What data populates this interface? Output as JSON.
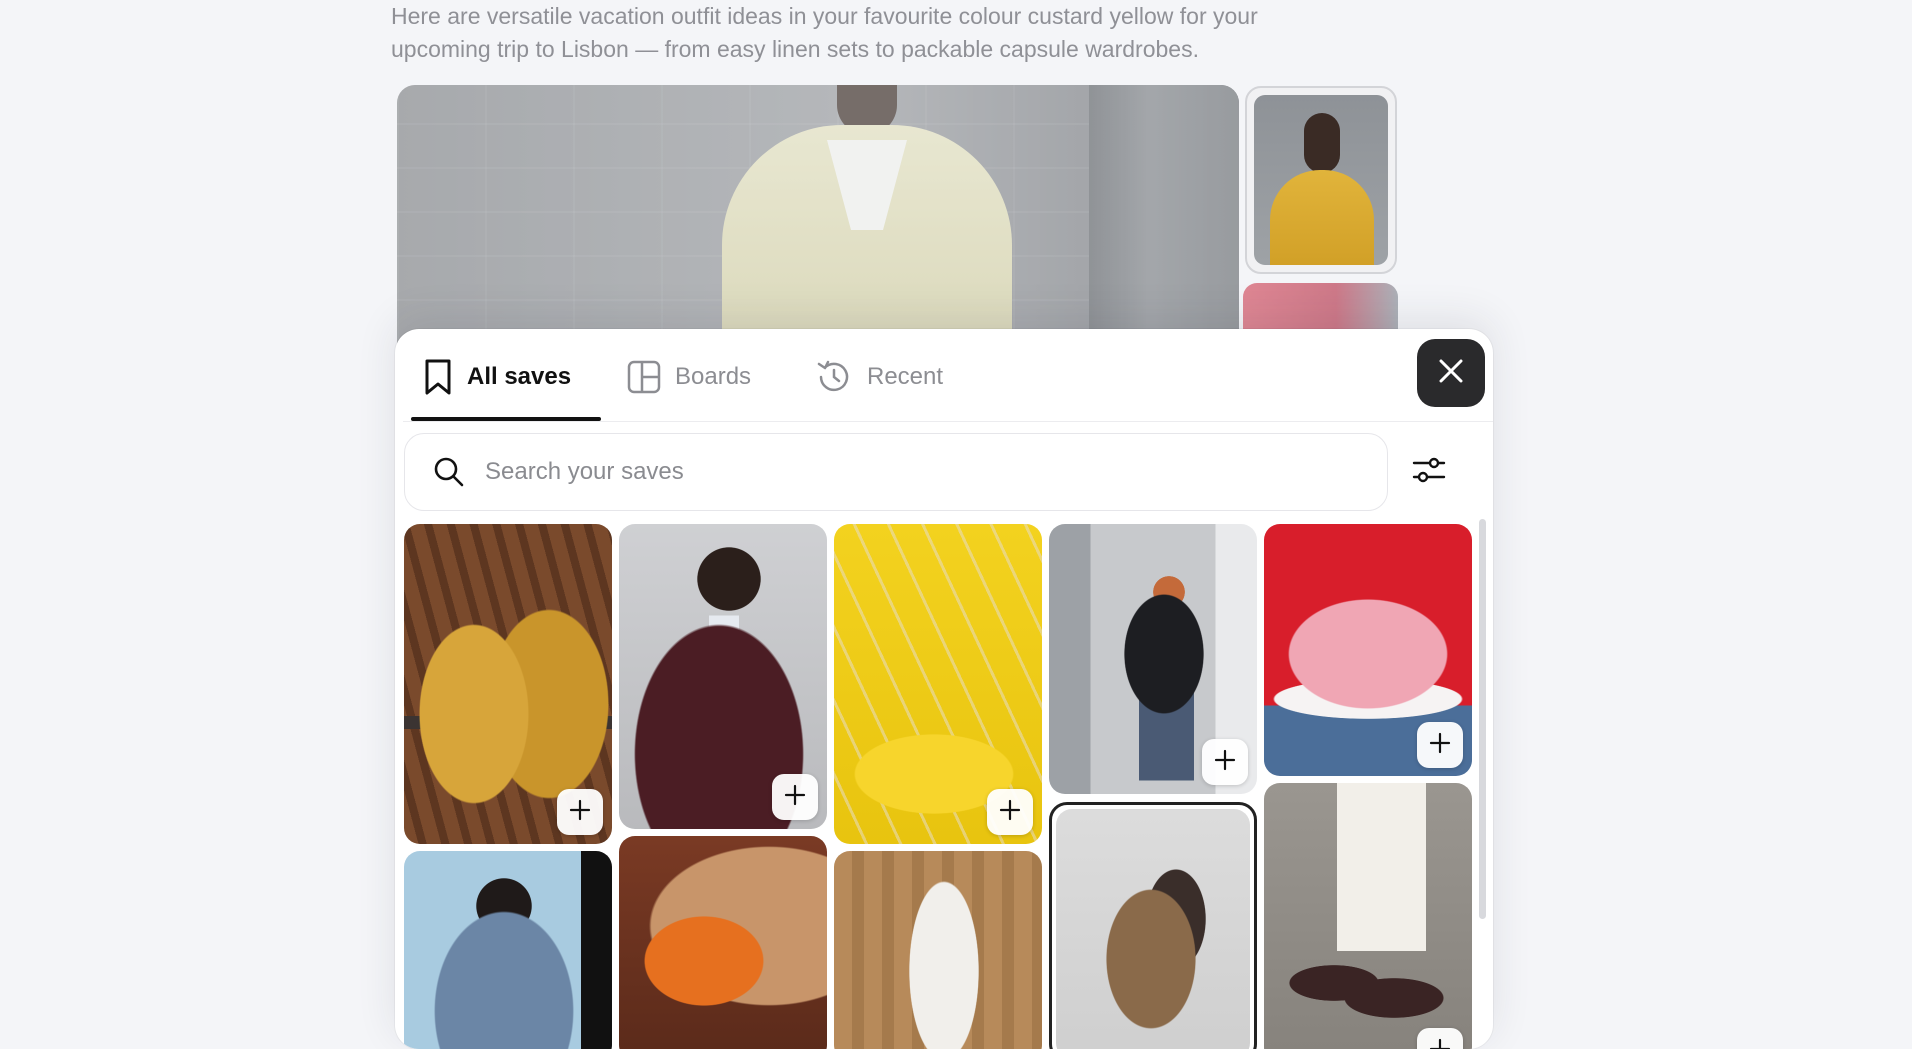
{
  "intro": {
    "line1": "Here are versatile vacation outfit ideas in your favourite colour custard yellow for your",
    "line2": "upcoming trip to Lisbon — from easy linen sets to packable capsule wardrobes."
  },
  "tabs": [
    {
      "label": "All saves",
      "icon": "bookmark-icon",
      "active": true
    },
    {
      "label": "Boards",
      "icon": "boards-icon",
      "active": false
    },
    {
      "label": "Recent",
      "icon": "history-icon",
      "active": false
    }
  ],
  "search": {
    "placeholder": "Search your saves",
    "value": ""
  },
  "icons": {
    "close": "close-icon",
    "filter": "sliders-icon",
    "search": "search-icon",
    "add": "plus-icon"
  },
  "saves": [
    {
      "subject": "Yellow suede lace-up boots"
    },
    {
      "subject": "Woman in burgundy suit and tie"
    },
    {
      "subject": "Yellow chairs on yellow floor"
    },
    {
      "subject": "Person in black jacket and wide jeans"
    },
    {
      "subject": "Pink cake with cherries"
    },
    {
      "subject": "Person in denim jacket"
    },
    {
      "subject": "Orange film camera and tan bag"
    },
    {
      "subject": "Person in white outfit against wood wall"
    },
    {
      "subject": "Person seated on chrome chair"
    },
    {
      "subject": "White skirt with mesh shoes"
    }
  ],
  "colors": {
    "accent": "#111111",
    "close_bg": "#2a2a2c",
    "yellow": "#f2cf1f"
  }
}
